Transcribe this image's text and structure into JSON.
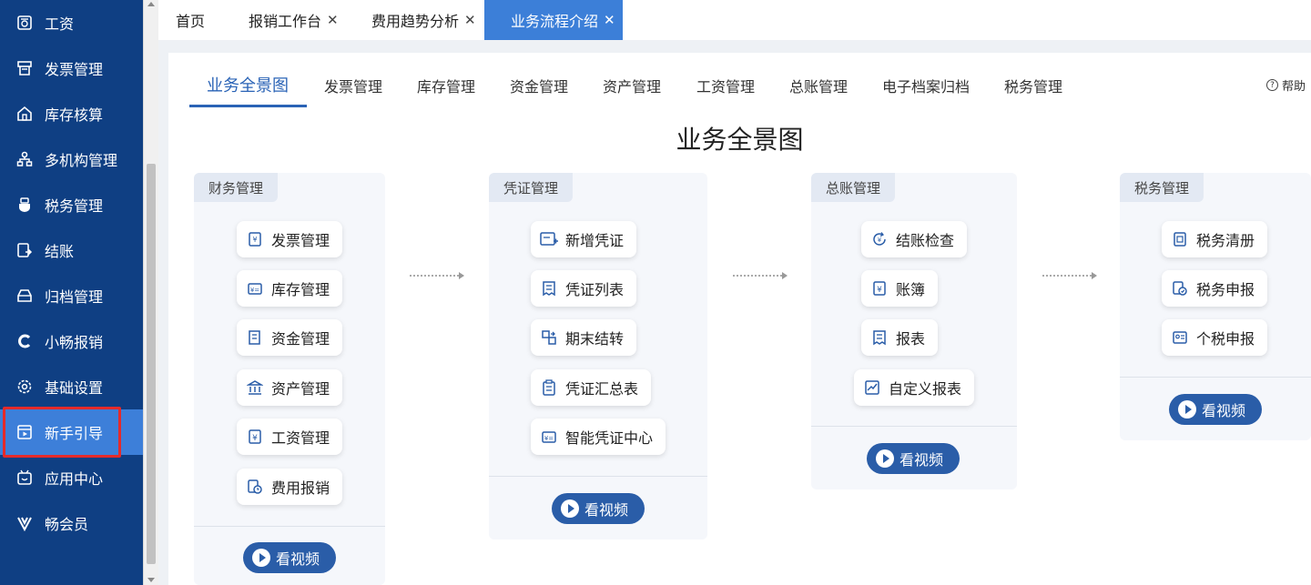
{
  "sidebar": {
    "items": [
      {
        "label": "工资",
        "icon": "salary-icon"
      },
      {
        "label": "发票管理",
        "icon": "invoice-icon"
      },
      {
        "label": "库存核算",
        "icon": "warehouse-icon"
      },
      {
        "label": "多机构管理",
        "icon": "org-tree-icon"
      },
      {
        "label": "税务管理",
        "icon": "tax-icon"
      },
      {
        "label": "结账",
        "icon": "checkout-icon"
      },
      {
        "label": "归档管理",
        "icon": "archive-icon"
      },
      {
        "label": "小畅报销",
        "icon": "expense-c-icon"
      },
      {
        "label": "基础设置",
        "icon": "gear-icon"
      },
      {
        "label": "新手引导",
        "icon": "guide-video-icon"
      },
      {
        "label": "应用中心",
        "icon": "app-center-icon"
      },
      {
        "label": "畅会员",
        "icon": "vip-v-icon"
      }
    ],
    "active_index": 9
  },
  "tabs": [
    {
      "label": "首页",
      "closable": false
    },
    {
      "label": "报销工作台",
      "closable": true
    },
    {
      "label": "费用趋势分析",
      "closable": true
    },
    {
      "label": "业务流程介绍",
      "closable": true,
      "active": true
    }
  ],
  "close_glyph": "✕",
  "subnav": [
    "业务全景图",
    "发票管理",
    "库存管理",
    "资金管理",
    "资产管理",
    "工资管理",
    "总账管理",
    "电子档案归档",
    "税务管理"
  ],
  "help_label": "帮助",
  "help_glyph": "?",
  "page_title": "业务全景图",
  "video_label": "看视频",
  "columns": [
    {
      "title": "财务管理",
      "items": [
        "发票管理",
        "库存管理",
        "资金管理",
        "资产管理",
        "工资管理",
        "费用报销"
      ]
    },
    {
      "title": "凭证管理",
      "items": [
        "新增凭证",
        "凭证列表",
        "期末结转",
        "凭证汇总表",
        "智能凭证中心"
      ]
    },
    {
      "title": "总账管理",
      "items": [
        "结账检查",
        "账簿",
        "报表",
        "自定义报表"
      ]
    },
    {
      "title": "税务管理",
      "items": [
        "税务清册",
        "税务申报",
        "个税申报"
      ]
    }
  ],
  "colors": {
    "sidebar_bg": "#0f3f83",
    "active_blue": "#3c7fd8",
    "brand": "#2a5da8",
    "highlight_red": "#e52a2a"
  }
}
